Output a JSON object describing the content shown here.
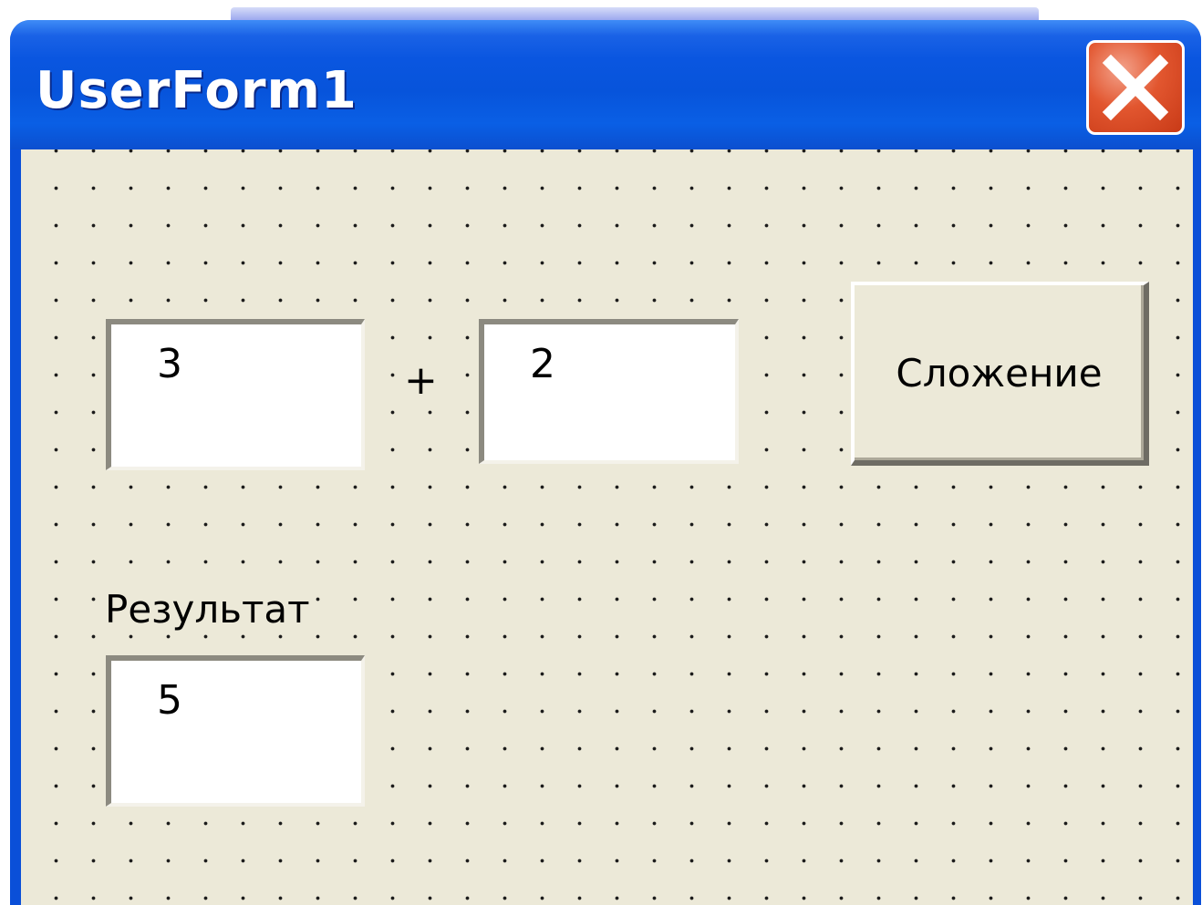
{
  "window": {
    "title": "UserForm1"
  },
  "form": {
    "operand1": "3",
    "operator": "+",
    "operand2": "2",
    "add_button_label": "Сложение",
    "result_label": "Результат",
    "result_value": "5"
  },
  "icons": {
    "close": "close-icon"
  },
  "colors": {
    "titlebar": "#0754db",
    "client_background": "#ece9d8",
    "close_button": "#e2562f"
  }
}
